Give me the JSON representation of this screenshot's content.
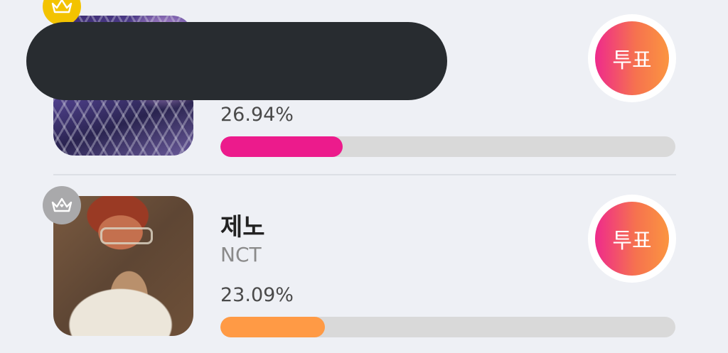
{
  "vote_label": "투표",
  "entries": [
    {
      "rank_icon": "gold-crown-icon",
      "percent_text": "26.94%",
      "percent_value": 26.94,
      "bar_color": "#ec1b8c"
    },
    {
      "rank_icon": "silver-crown-icon",
      "name": "제노",
      "group": "NCT",
      "percent_text": "23.09%",
      "percent_value": 23.09,
      "bar_color": "#ff9a45"
    }
  ],
  "colors": {
    "background": "#eef0f5",
    "track": "#d9d9d9",
    "vote_gradient_start": "#ee2a8c",
    "vote_gradient_end": "#fb9540",
    "gold": "#f3c300",
    "silver": "#a9a9ab"
  }
}
